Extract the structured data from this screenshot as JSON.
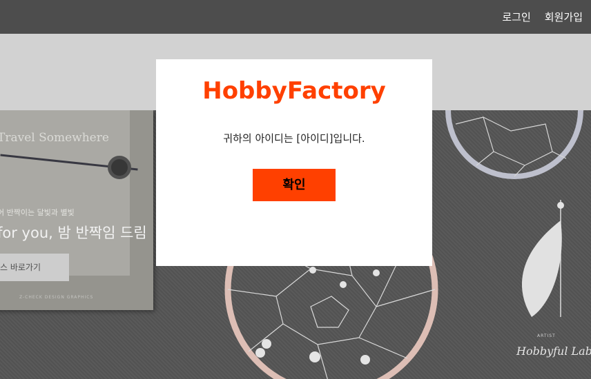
{
  "header": {
    "login_label": "로그인",
    "signup_label": "회원가입"
  },
  "hero": {
    "card_title": "Travel  Somewhere",
    "card_small_text": "어 반짝이는 달빛과 별빛",
    "card_big_text": "for you, 밤 반짝임 드림",
    "card_button_label": "스 바로가기",
    "card_tiny_text": "Z-CHECK DESIGN GRAPHICS",
    "watermark_artist": "ARTIST",
    "watermark_signature": "Hobbyful Lab"
  },
  "modal": {
    "title": "HobbyFactory",
    "message": "귀하의 아이디는 [아이디]입니다.",
    "confirm_label": "확인"
  },
  "colors": {
    "brand": "#ff4000",
    "header_bg": "#4d4d4d",
    "band_bg": "#d2d2d2"
  }
}
